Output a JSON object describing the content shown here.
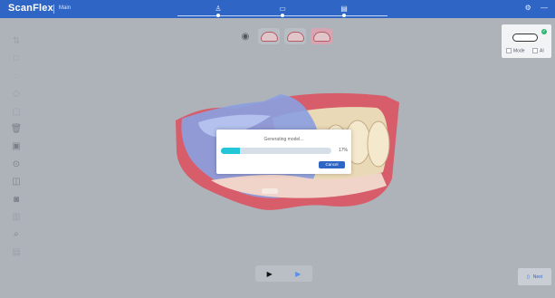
{
  "app": {
    "title": "ScanFlex",
    "subtitle": "Main"
  },
  "topbar": {
    "steps": [
      {
        "icon": "person-icon"
      },
      {
        "icon": "scan-icon"
      },
      {
        "icon": "document-icon"
      }
    ],
    "right_icons": [
      "settings-icon",
      "minimize-icon"
    ]
  },
  "sidebar": {
    "tools": [
      "measure-icon",
      "crop-icon",
      "lasso-icon",
      "view-icon",
      "clip-icon",
      "delete-icon",
      "cube-icon",
      "target-icon",
      "scan-icon",
      "camera-icon",
      "bar-icon",
      "zoom-icon",
      "layers-icon"
    ]
  },
  "view_tools": {
    "items": [
      "center-icon",
      "upper-jaw-icon",
      "lower-jaw-icon",
      "both-jaws-icon"
    ],
    "active": "both-jaws-icon"
  },
  "scanner": {
    "options": [
      "Mode",
      "AI"
    ],
    "status": "connected"
  },
  "modal": {
    "title": "Generating model...",
    "progress": 0.17,
    "progress_label": "17%",
    "cancel_label": "Cancel"
  },
  "playback": {
    "play_icon": "play-icon",
    "next_icon": "next-icon"
  },
  "next_button": {
    "label": "Next",
    "icon": "next-page-icon"
  },
  "colors": {
    "primary": "#2f66c6",
    "background": "#aeb3ba",
    "progress": "#22c6d7",
    "gum": "#d85d6b",
    "scan": "#8c9fdf",
    "teeth": "#ead9b6"
  }
}
